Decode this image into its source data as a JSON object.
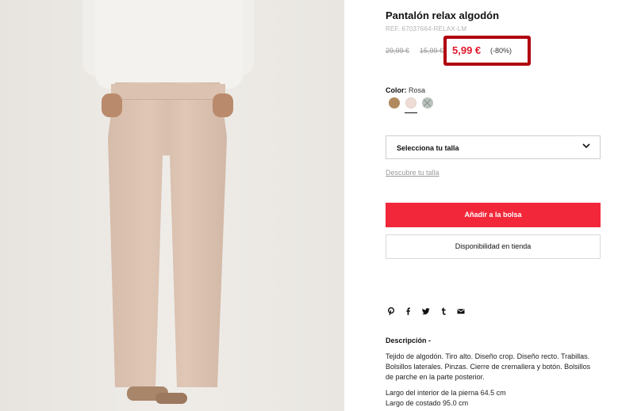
{
  "product": {
    "title": "Pantalón relax algodón",
    "ref": "REF. 67037664-RELAX-LM",
    "price_original": "29,99 €",
    "price_previous": "15,99 €",
    "price_current": "5,99 €",
    "discount": "(-80%)"
  },
  "color": {
    "label": "Color:",
    "selected": "Rosa",
    "swatches": [
      {
        "name": "camel",
        "hex": "#b08a5e"
      },
      {
        "name": "rosa",
        "hex": "#efdcd6"
      },
      {
        "name": "unavailable",
        "hex": "#b8c1bb"
      }
    ]
  },
  "size": {
    "select_label": "Selecciona tu talla",
    "guide_link": "Descubre tu talla"
  },
  "actions": {
    "add_to_bag": "Añadir a la bolsa",
    "store_availability": "Disponibilidad en tienda"
  },
  "share": {
    "icons": [
      "pinterest-icon",
      "facebook-icon",
      "twitter-icon",
      "tumblr-icon",
      "email-icon"
    ]
  },
  "description": {
    "title": "Descripción  -",
    "body": "Tejido de algodón. Tiro alto. Diseño crop. Diseño recto. Trabillas. Bolsillos laterales. Pinzas. Cierre de cremallera y botón. Bolsillos de parche en la parte posterior.",
    "inner_leg": "Largo del interior de la pierna 64.5 cm",
    "side_length": "Largo de costado 95.0 cm"
  },
  "colors": {
    "accent": "#f2283a",
    "price_sale": "#e0182d",
    "highlight_border": "#b00010"
  }
}
